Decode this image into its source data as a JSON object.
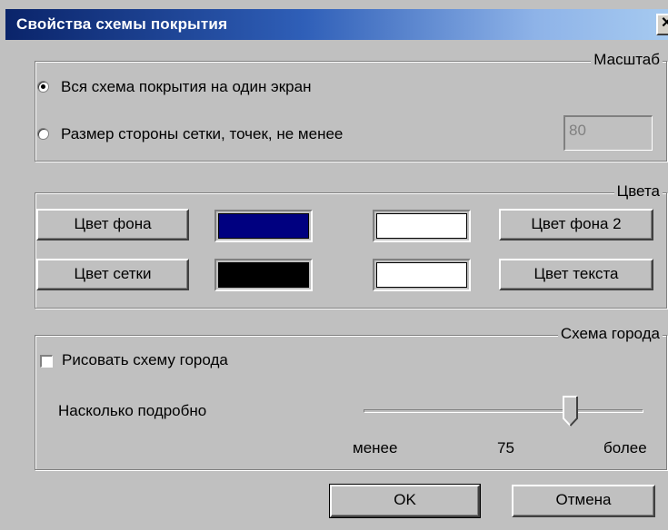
{
  "window": {
    "title": "Свойства схемы покрытия",
    "close_glyph": "✕"
  },
  "scale_group": {
    "legend": "Масштаб",
    "option_whole": "Вся схема покрытия на один экран",
    "option_grid": "Размер стороны сетки, точек, не менее",
    "selected": "whole",
    "grid_size_value": "80"
  },
  "colors_group": {
    "legend": "Цвета",
    "bg_button": "Цвет фона",
    "grid_button": "Цвет сетки",
    "bg2_button": "Цвет фона 2",
    "text_button": "Цвет текста",
    "bg_color": "#000080",
    "grid_color": "#000000",
    "bg2_color": "#ffffff",
    "text_color": "#ffffff"
  },
  "city_group": {
    "legend": "Схема города",
    "draw_checkbox": "Рисовать схему города",
    "draw_checked": false,
    "detail_label": "Насколько подробно",
    "min_label": "менее",
    "max_label": "более",
    "detail_value": "75",
    "detail_fraction": 0.75
  },
  "buttons": {
    "ok": "OK",
    "cancel": "Отмена"
  }
}
